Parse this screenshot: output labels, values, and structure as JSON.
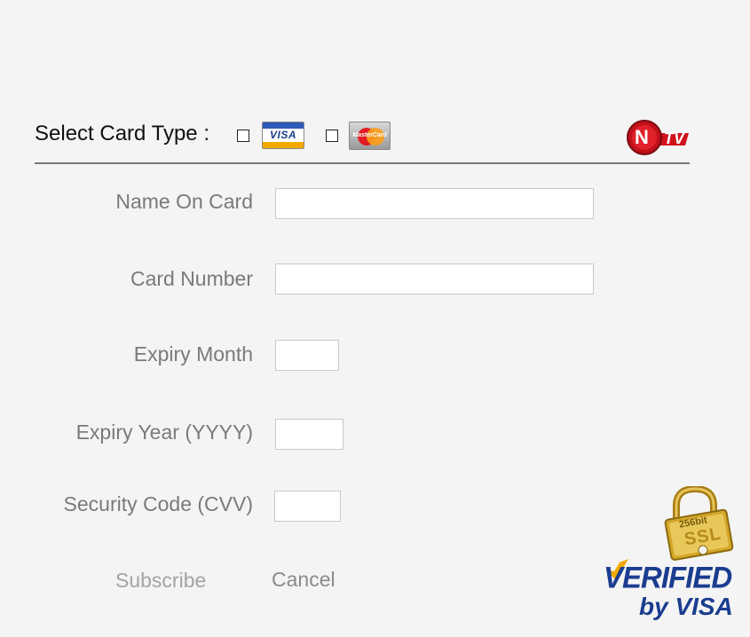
{
  "card_selector": {
    "label": "Select Card Type :",
    "options": [
      {
        "name": "visa",
        "logo_text": "VISA",
        "checked": false
      },
      {
        "name": "mastercard",
        "logo_text": "MasterCard",
        "checked": false
      }
    ]
  },
  "brand_logo": {
    "n": "N",
    "tv": "TV"
  },
  "form": {
    "name_label": "Name On Card",
    "name_value": "",
    "number_label": "Card Number",
    "number_value": "",
    "month_label": "Expiry Month",
    "month_value": "",
    "year_label": "Expiry Year (YYYY)",
    "year_value": "",
    "cvv_label": "Security Code (CVV)",
    "cvv_value": ""
  },
  "actions": {
    "subscribe": "Subscribe",
    "cancel": "Cancel"
  },
  "badges": {
    "ssl_bits": "256bit",
    "ssl_text": "SSL",
    "verified": "VERIFIED",
    "by_visa": "by VISA"
  },
  "colors": {
    "visa_blue": "#1a3d8f",
    "visa_gold": "#f2a900",
    "mc_red": "#e31b23",
    "mc_orange": "#f79e1b",
    "ntv_red": "#d0121b",
    "lock_gold": "#d4a72a"
  }
}
